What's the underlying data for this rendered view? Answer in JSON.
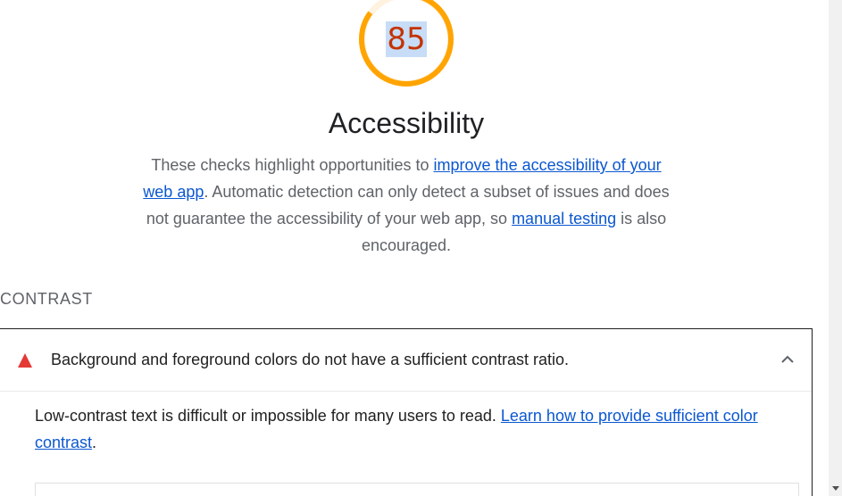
{
  "score": {
    "value": "85",
    "fraction": 0.85,
    "color": "#ffa400",
    "track_color": "#fff3e0",
    "text_color": "#c33300"
  },
  "category": {
    "title": "Accessibility",
    "description": {
      "part1": "These checks highlight opportunities to ",
      "link1": "improve the accessibility of your web app",
      "part2": ". Automatic detection can only detect a subset of issues and does not guarantee the accessibility of your web app, so ",
      "link2": "manual testing",
      "part3": " is also encouraged."
    }
  },
  "group": {
    "title": "CONTRAST"
  },
  "audit": {
    "status_icon": "fail-triangle-icon",
    "status_color": "#e53935",
    "title": "Background and foreground colors do not have a sufficient contrast ratio.",
    "expanded": true,
    "chevron_icon": "chevron-up-icon",
    "details": {
      "text": "Low-contrast text is difficult or impossible for many users to read. ",
      "link": "Learn how to provide sufficient color contrast",
      "after": "."
    }
  },
  "colors": {
    "link": "#0b57d0",
    "muted_text": "#5f6368"
  }
}
